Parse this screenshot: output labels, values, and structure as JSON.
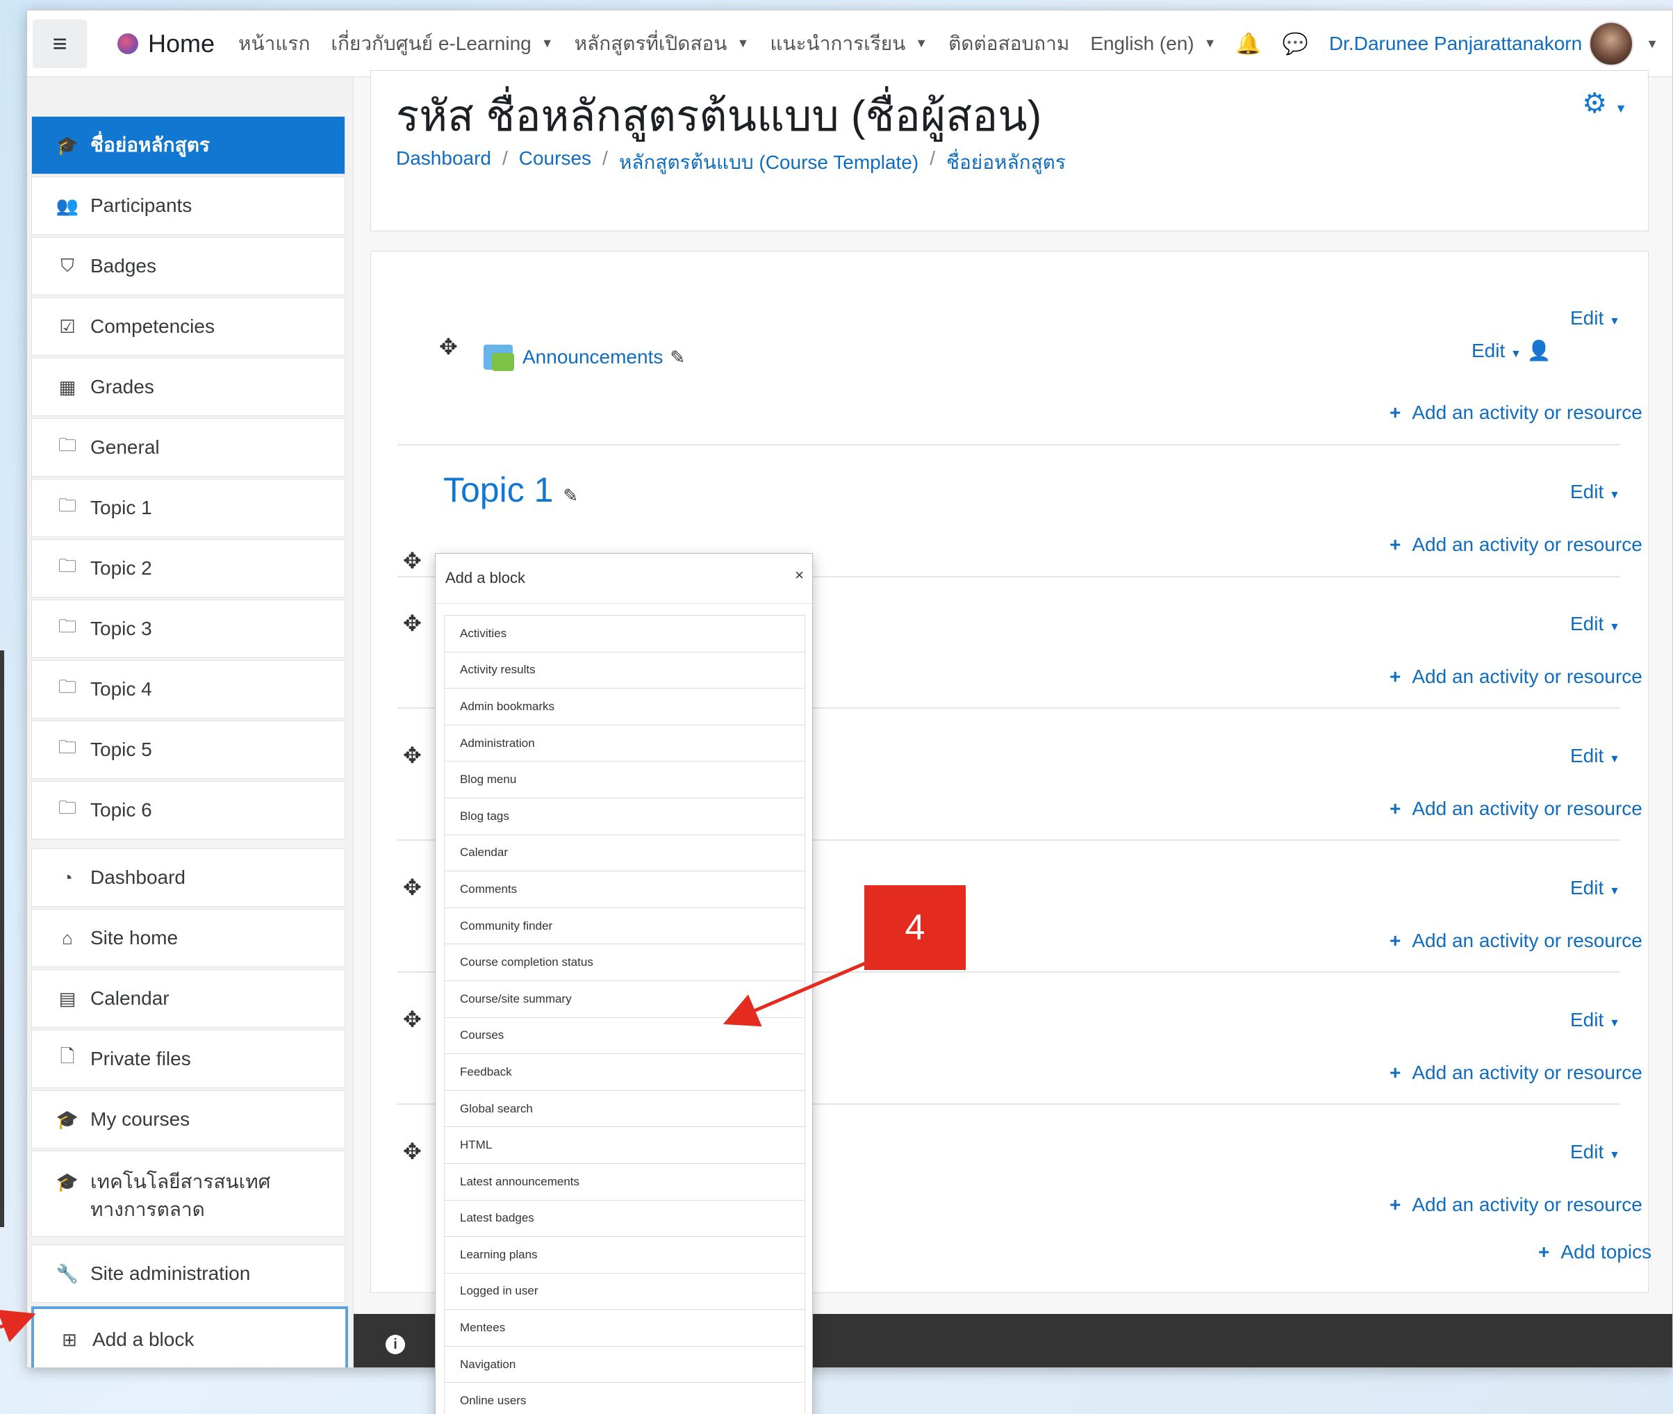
{
  "navbar": {
    "menu_icon": "hamburger-icon",
    "brand": "Home",
    "items": [
      {
        "label": "หน้าแรก",
        "has_caret": false
      },
      {
        "label": "เกี่ยวกับศูนย์ e-Learning",
        "has_caret": true
      },
      {
        "label": "หลักสูตรที่เปิดสอน",
        "has_caret": true
      },
      {
        "label": "แนะนำการเรียน",
        "has_caret": true
      },
      {
        "label": "ติดต่อสอบถาม",
        "has_caret": false
      },
      {
        "label": "English (en)",
        "has_caret": true
      }
    ],
    "user_name": "Dr.Darunee Panjarattanakorn"
  },
  "drawer": {
    "items": [
      {
        "label": "ชื่อย่อหลักสูตร",
        "icon": "graduation-cap-icon"
      },
      {
        "label": "Participants",
        "icon": "users-icon"
      },
      {
        "label": "Badges",
        "icon": "shield-icon"
      },
      {
        "label": "Competencies",
        "icon": "check-square-icon"
      },
      {
        "label": "Grades",
        "icon": "table-icon"
      },
      {
        "label": "General",
        "icon": "folder-icon"
      },
      {
        "label": "Topic 1",
        "icon": "folder-icon"
      },
      {
        "label": "Topic 2",
        "icon": "folder-icon"
      },
      {
        "label": "Topic 3",
        "icon": "folder-icon"
      },
      {
        "label": "Topic 4",
        "icon": "folder-icon"
      },
      {
        "label": "Topic 5",
        "icon": "folder-icon"
      },
      {
        "label": "Topic 6",
        "icon": "folder-icon"
      },
      {
        "label": "Dashboard",
        "icon": "dashboard-icon"
      },
      {
        "label": "Site home",
        "icon": "home-icon"
      },
      {
        "label": "Calendar",
        "icon": "calendar-icon"
      },
      {
        "label": "Private files",
        "icon": "file-icon"
      },
      {
        "label": "My courses",
        "icon": "graduation-cap-icon"
      },
      {
        "label_line1": "เทคโนโลยีสารสนเทศ",
        "label_line2": "ทางการตลาด",
        "icon": "graduation-cap-icon"
      },
      {
        "label": "Site administration",
        "icon": "wrench-icon"
      },
      {
        "label": "Add a block",
        "icon": "plus-square-icon"
      }
    ]
  },
  "header": {
    "title": "รหัส ชื่อหลักสูตรต้นแบบ (ชื่อผู้สอน)",
    "breadcrumb": [
      "Dashboard",
      "Courses",
      "หลักสูตรต้นแบบ (Course Template)",
      "ชื่อย่อหลักสูตร"
    ]
  },
  "course": {
    "edit_label": "Edit",
    "add_activity_label": "Add an activity or resource",
    "announcements_label": "Announcements",
    "topic1_title": "Topic 1",
    "add_topics_label": "Add topics"
  },
  "modal": {
    "title": "Add a block",
    "close": "×",
    "blocks": [
      "Activities",
      "Activity results",
      "Admin bookmarks",
      "Administration",
      "Blog menu",
      "Blog tags",
      "Calendar",
      "Comments",
      "Community finder",
      "Course completion status",
      "Course/site summary",
      "Courses",
      "Feedback",
      "Global search",
      "HTML",
      "Latest announcements",
      "Latest badges",
      "Learning plans",
      "Logged in user",
      "Mentees",
      "Navigation",
      "Online users"
    ]
  },
  "callout": {
    "number": "4",
    "color": "#e42b20"
  },
  "colors": {
    "accent": "#1177d1",
    "link": "#0f6cbf"
  }
}
